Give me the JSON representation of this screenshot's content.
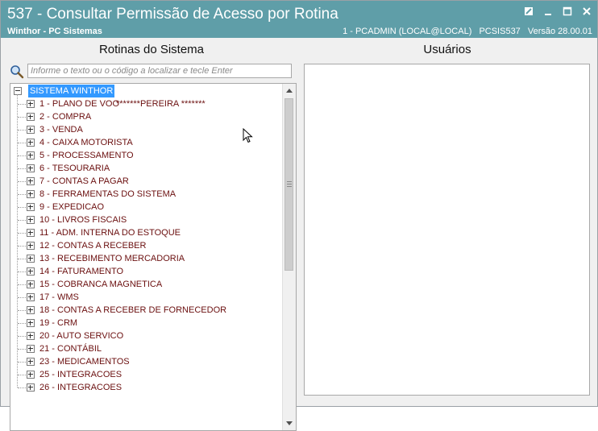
{
  "window": {
    "title": "537 - Consultar Permissão de Acesso por Rotina",
    "app_name": "Winthor - PC Sistemas",
    "user_info": "1 - PCADMIN (LOCAL@LOCAL)",
    "program_code": "PCSIS537",
    "version": "Versão 28.00.01",
    "titlebar_color": "#5f9ea8"
  },
  "left_panel": {
    "title": "Rotinas do Sistema",
    "search_placeholder": "Informe o texto ou o código a localizar e tecle Enter",
    "search_value": "",
    "tree": {
      "root_label": "SISTEMA WINTHOR",
      "items": [
        {
          "label": "1 - PLANO DE VOO",
          "extra": "*******PEREIRA *******"
        },
        {
          "label": "2 - COMPRA"
        },
        {
          "label": "3 - VENDA"
        },
        {
          "label": "4 - CAIXA MOTORISTA"
        },
        {
          "label": "5 - PROCESSAMENTO"
        },
        {
          "label": "6 - TESOURARIA"
        },
        {
          "label": "7 - CONTAS A PAGAR"
        },
        {
          "label": "8 - FERRAMENTAS DO SISTEMA"
        },
        {
          "label": "9 - EXPEDICAO"
        },
        {
          "label": "10 - LIVROS FISCAIS"
        },
        {
          "label": "11 - ADM. INTERNA DO ESTOQUE"
        },
        {
          "label": "12 - CONTAS A RECEBER"
        },
        {
          "label": "13 - RECEBIMENTO MERCADORIA"
        },
        {
          "label": "14 - FATURAMENTO"
        },
        {
          "label": "15 - COBRANCA MAGNETICA"
        },
        {
          "label": "17 - WMS"
        },
        {
          "label": "18 - CONTAS A RECEBER DE FORNECEDOR"
        },
        {
          "label": "19 - CRM"
        },
        {
          "label": "20 - AUTO SERVICO"
        },
        {
          "label": "21 - CONTÁBIL"
        },
        {
          "label": "23 - MEDICAMENTOS"
        },
        {
          "label": "25 - INTEGRACOES"
        },
        {
          "label": "26 - INTEGRACOES"
        }
      ]
    },
    "item_text_color": "#6b0f0f",
    "selection_color": "#3399ff"
  },
  "right_panel": {
    "title": "Usuários"
  }
}
